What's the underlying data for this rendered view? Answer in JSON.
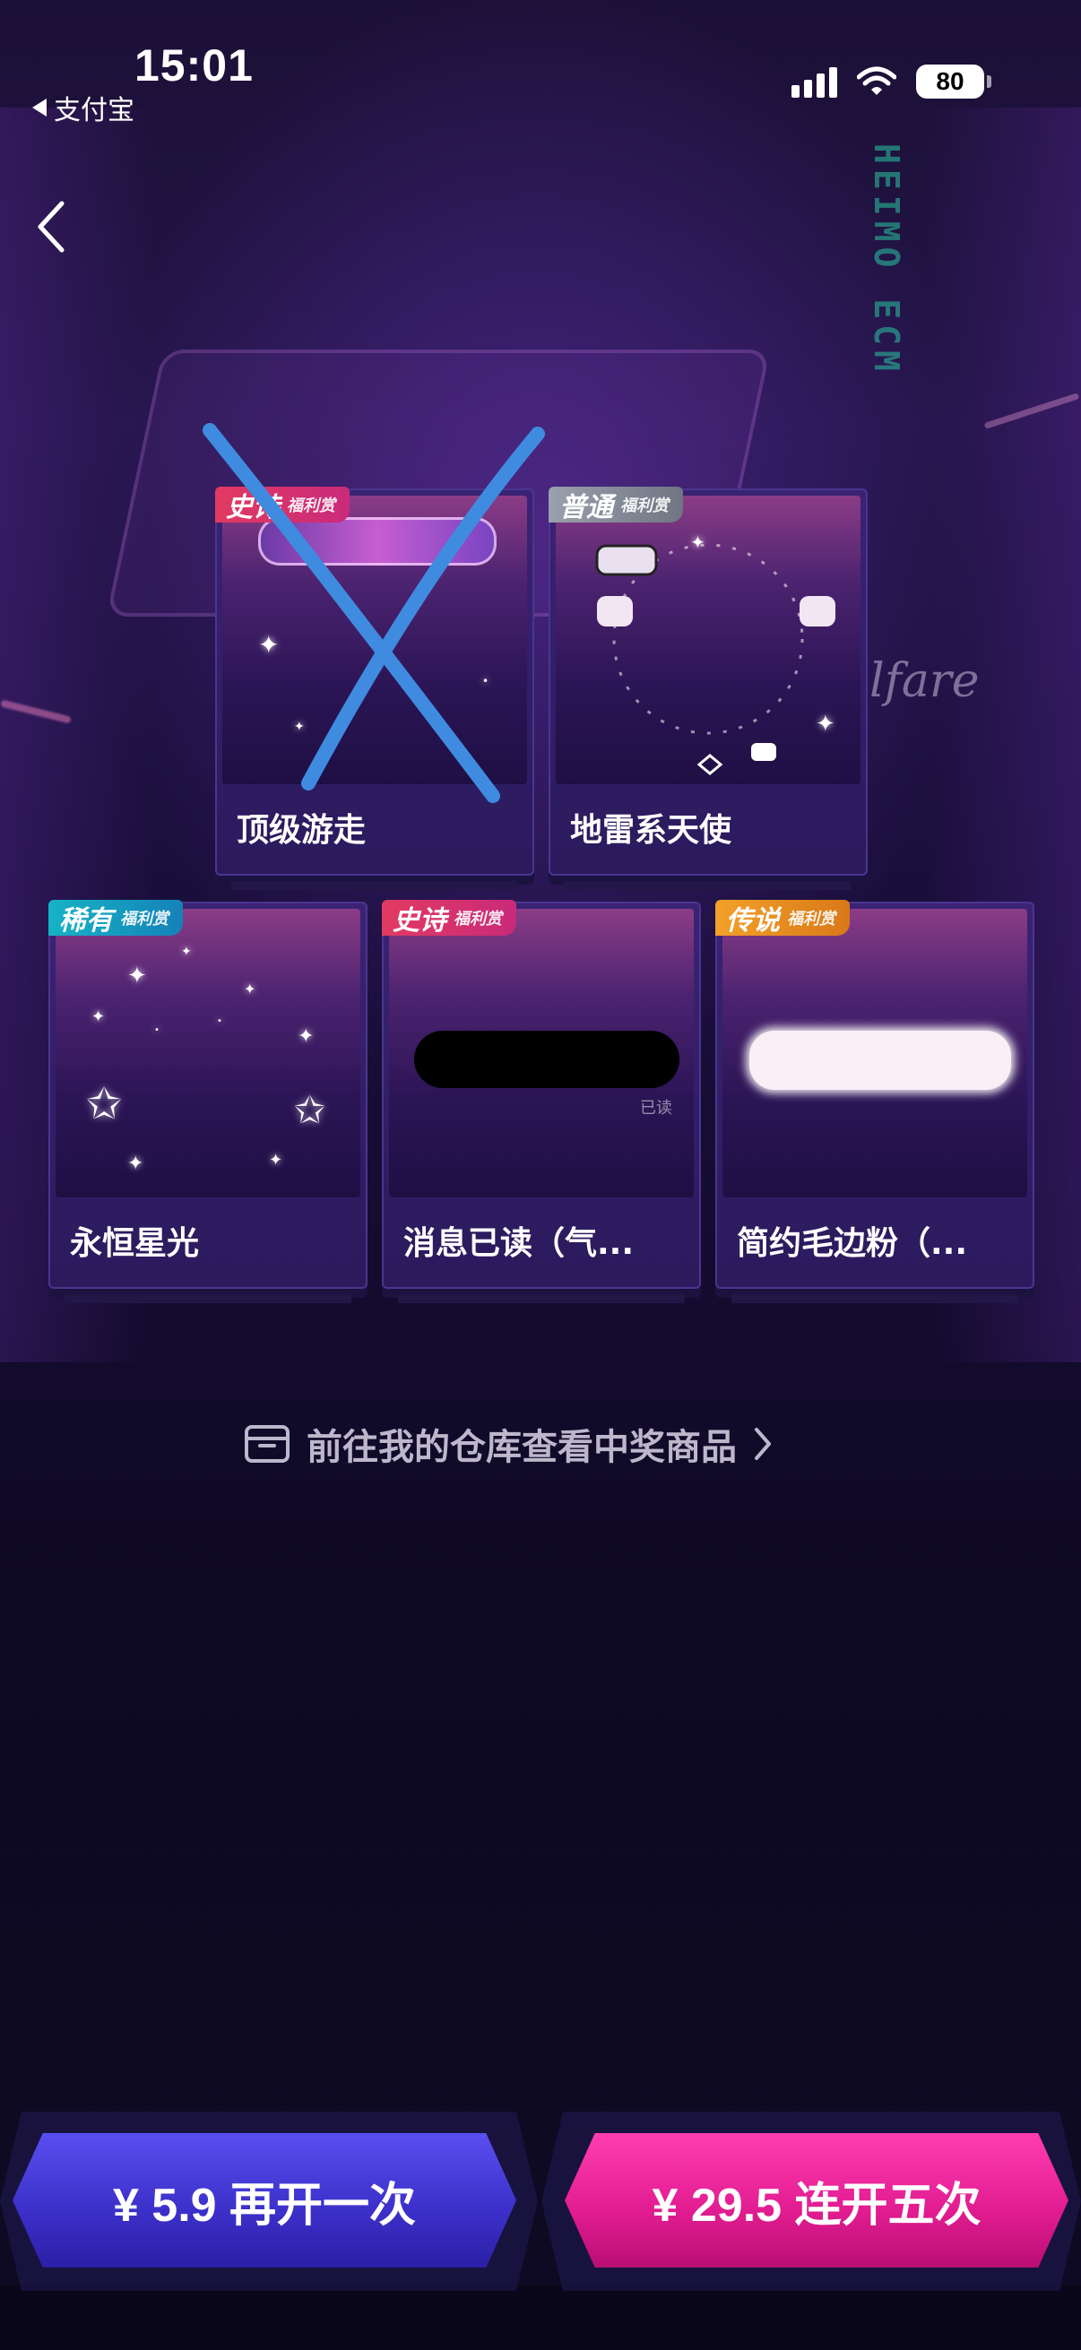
{
  "status_bar": {
    "time": "15:01",
    "back_app": "支付宝",
    "battery": "80"
  },
  "cards": [
    {
      "rarity": "史诗",
      "tag": "福利赏",
      "name": "顶级游走",
      "crossed_out": true
    },
    {
      "rarity": "普通",
      "tag": "福利赏",
      "name": "地雷系天使"
    },
    {
      "rarity": "稀有",
      "tag": "福利赏",
      "name": "永恒星光"
    },
    {
      "rarity": "史诗",
      "tag": "福利赏",
      "name": "消息已读（气...",
      "bubble_text": "已读"
    },
    {
      "rarity": "传说",
      "tag": "福利赏",
      "name": "简约毛边粉（..."
    }
  ],
  "warehouse_link": {
    "label": "前往我的仓库查看中奖商品"
  },
  "buttons": {
    "open_once": "¥ 5.9 再开一次",
    "open_five": "¥ 29.5 连开五次"
  },
  "background": {
    "welfare_text": "lfare"
  },
  "colors": {
    "epic": "#e23a62",
    "normal": "#8a909c",
    "rare": "#16b3c6",
    "legend": "#f2a12a",
    "btn_once": "#4a3ee0",
    "btn_five": "#f02aa0"
  }
}
